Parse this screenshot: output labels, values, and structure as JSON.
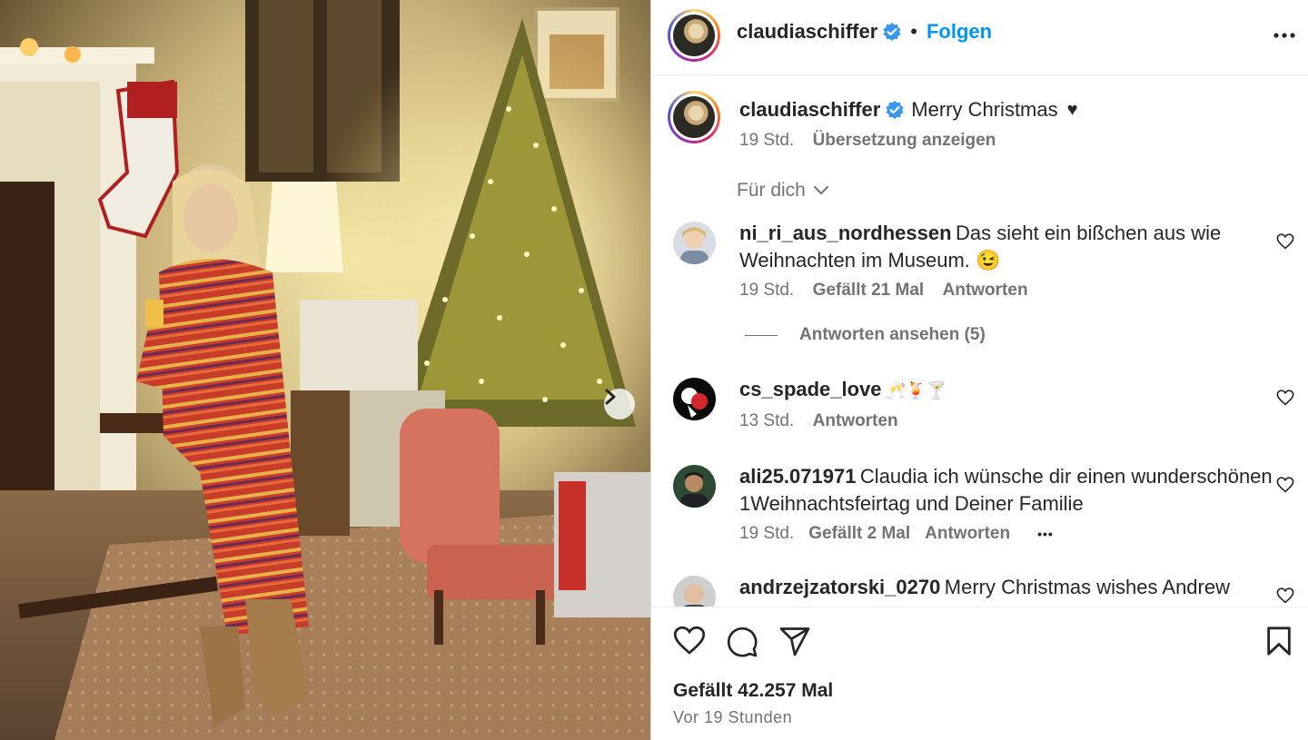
{
  "post": {
    "username": "claudiaschiffer",
    "follow_label": "Folgen",
    "separator": "•",
    "caption_text": "Merry Christmas",
    "caption_emoji": "♥",
    "caption_time": "19 Std.",
    "translate_label": "Übersetzung anzeigen",
    "sort_label": "Für dich"
  },
  "comments": [
    {
      "username": "ni_ri_aus_nordhessen",
      "text": "Das sieht ein bißchen aus wie Weihnachten im Museum. 😉",
      "time": "19 Std.",
      "likes": "Gefällt 21 Mal",
      "reply": "Antworten",
      "view_replies": "Antworten ansehen (5)"
    },
    {
      "username": "cs_spade_love",
      "text": "🥂🍹🍸",
      "time": "13 Std.",
      "reply": "Antworten"
    },
    {
      "username": "ali25.071971",
      "text": "Claudia ich wünsche dir einen wunderschönen 1Weihnachtsfeirtag und Deiner Familie",
      "time": "19 Std.",
      "likes": "Gefällt 2 Mal",
      "reply": "Antworten",
      "more": "•••"
    },
    {
      "username": "andrzejzatorski_0270",
      "text": "Merry Christmas wishes Andrew"
    }
  ],
  "footer": {
    "like_count": "Gefällt 42.257 Mal",
    "posted": "Vor 19 Stunden"
  },
  "icons": {
    "verified": "verified-badge-icon",
    "more": "more-options-icon",
    "heart": "heart-icon",
    "comment": "comment-bubble-icon",
    "share": "paper-plane-icon",
    "save": "bookmark-icon",
    "next": "chevron-right-icon"
  },
  "colors": {
    "link": "#0095f6",
    "text": "#262626",
    "muted": "#737373",
    "verified": "#3897f0"
  }
}
